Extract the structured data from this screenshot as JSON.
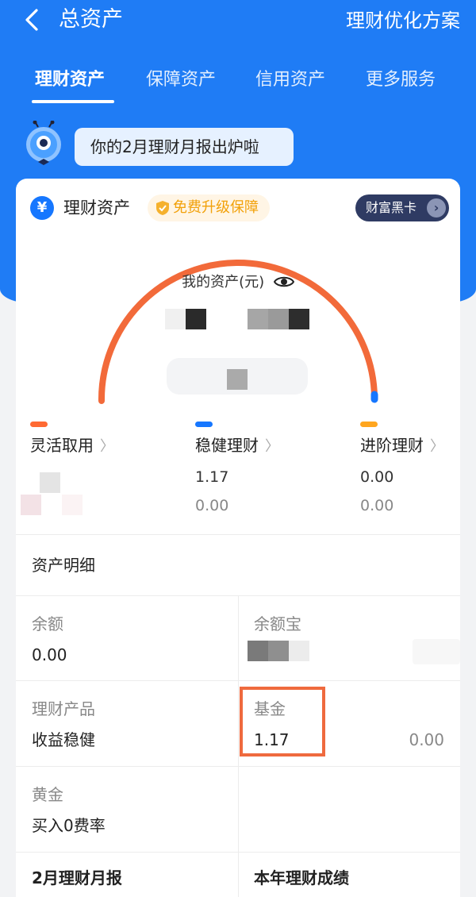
{
  "header": {
    "title": "总资产",
    "action": "理财优化方案"
  },
  "tabs": [
    {
      "label": "理财资产",
      "active": true
    },
    {
      "label": "保障资产",
      "active": false
    },
    {
      "label": "信用资产",
      "active": false
    },
    {
      "label": "更多服务",
      "active": false
    }
  ],
  "banner": {
    "text": "你的2月理财月报出炉啦"
  },
  "card": {
    "icon": "¥",
    "title": "理财资产",
    "upgrade_badge": "免费升级保障",
    "blackcard": "财富黑卡",
    "total_label": "我的资产(元)"
  },
  "categories": [
    {
      "label": "灵活取用",
      "color": "#ff6a33",
      "value": "",
      "sub": ""
    },
    {
      "label": "稳健理财",
      "color": "#1677ff",
      "value": "1.17",
      "sub": "0.00"
    },
    {
      "label": "进阶理财",
      "color": "#ffa61f",
      "value": "0.00",
      "sub": "0.00"
    }
  ],
  "details": {
    "title": "资产明细",
    "cells": [
      {
        "label": "余额",
        "value": "0.00"
      },
      {
        "label": "余额宝",
        "value": ""
      },
      {
        "label": "理财产品",
        "value": "收益稳健"
      },
      {
        "label": "基金",
        "value": "1.17",
        "right": "0.00"
      },
      {
        "label": "黄金",
        "value": "买入0费率"
      }
    ]
  },
  "bottom": {
    "left": "2月理财月报",
    "right": "本年理财成绩"
  },
  "colors": {
    "primary": "#1f7cf5",
    "arc": "#f26a3a",
    "highlight": "#ef6a3e"
  }
}
